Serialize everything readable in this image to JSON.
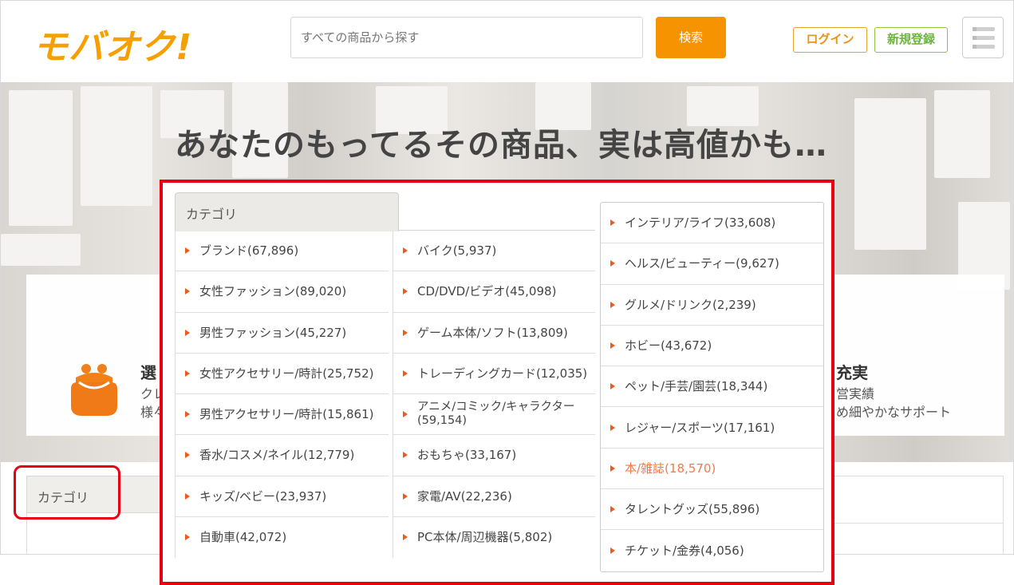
{
  "header": {
    "logo": "モバオク!",
    "search_placeholder": "すべての商品から探す",
    "search_button": "検索",
    "login_button": "ログイン",
    "register_button": "新規登録",
    "menu_icon": "hamburger-menu-icon"
  },
  "hero": {
    "headline": "あなたのもってるその商品、実は高値かも…",
    "left_feature": {
      "icon": "wallet-icon",
      "heading": "選",
      "line1": "クレ",
      "line2": "様々"
    },
    "right_feature": {
      "heading": "充実",
      "line1": "営実績",
      "line2": "め細やかなサポート"
    }
  },
  "section": {
    "category_tab": "カテゴリ"
  },
  "callout": {
    "accent_color": "#e60012",
    "category_tab": "カテゴリ",
    "columns": [
      [
        "ブランド(67,896)",
        "女性ファッション(89,020)",
        "男性ファッション(45,227)",
        "女性アクセサリー/時計(25,752)",
        "男性アクセサリー/時計(15,861)",
        "香水/コスメ/ネイル(12,779)",
        "キッズ/ベビー(23,937)",
        "自動車(42,072)"
      ],
      [
        "バイク(5,937)",
        "CD/DVD/ビデオ(45,098)",
        "ゲーム本体/ソフト(13,809)",
        "トレーディングカード(12,035)",
        "アニメ/コミック/キャラクター(59,154)",
        "おもちゃ(33,167)",
        "家電/AV(22,236)",
        "PC本体/周辺機器(5,802)"
      ],
      [
        "インテリア/ライフ(33,608)",
        "ヘルス/ビューティー(9,627)",
        "グルメ/ドリンク(2,239)",
        "ホビー(43,672)",
        "ペット/手芸/園芸(18,344)",
        "レジャー/スポーツ(17,161)",
        "本/雑誌(18,570)",
        "タレントグッズ(55,896)",
        "チケット/金券(4,056)"
      ]
    ],
    "active_item": "本/雑誌(18,570)"
  }
}
